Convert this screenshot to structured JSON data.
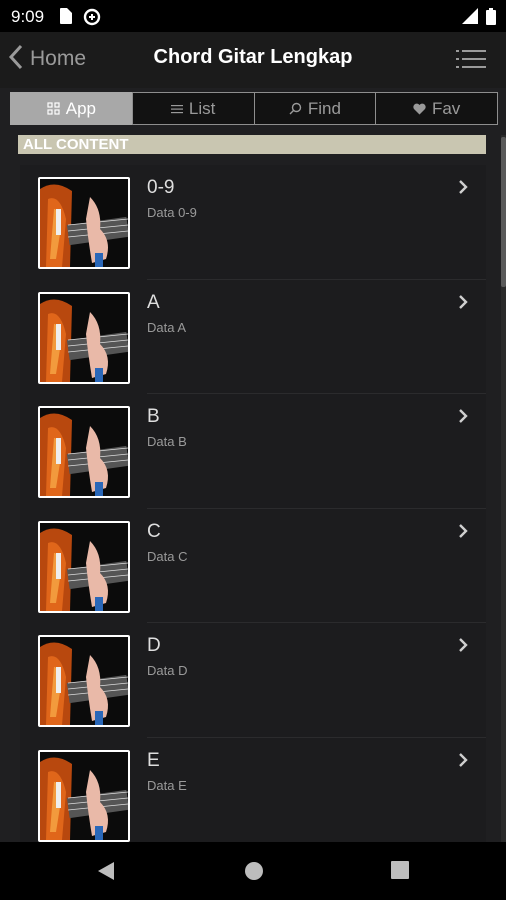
{
  "status_bar": {
    "time": "9:09"
  },
  "header": {
    "back_label": "Home",
    "title": "Chord Gitar Lengkap"
  },
  "tabs": [
    {
      "label": "App",
      "icon": "grid-icon",
      "active": true
    },
    {
      "label": "List",
      "icon": "list-icon",
      "active": false
    },
    {
      "label": "Find",
      "icon": "search-icon",
      "active": false
    },
    {
      "label": "Fav",
      "icon": "heart-icon",
      "active": false
    }
  ],
  "section": {
    "label": "ALL CONTENT"
  },
  "items": [
    {
      "title": "0-9",
      "subtitle": "Data 0-9"
    },
    {
      "title": "A",
      "subtitle": "Data A"
    },
    {
      "title": "B",
      "subtitle": "Data B"
    },
    {
      "title": "C",
      "subtitle": "Data C"
    },
    {
      "title": "D",
      "subtitle": "Data D"
    },
    {
      "title": "E",
      "subtitle": "Data E"
    }
  ]
}
